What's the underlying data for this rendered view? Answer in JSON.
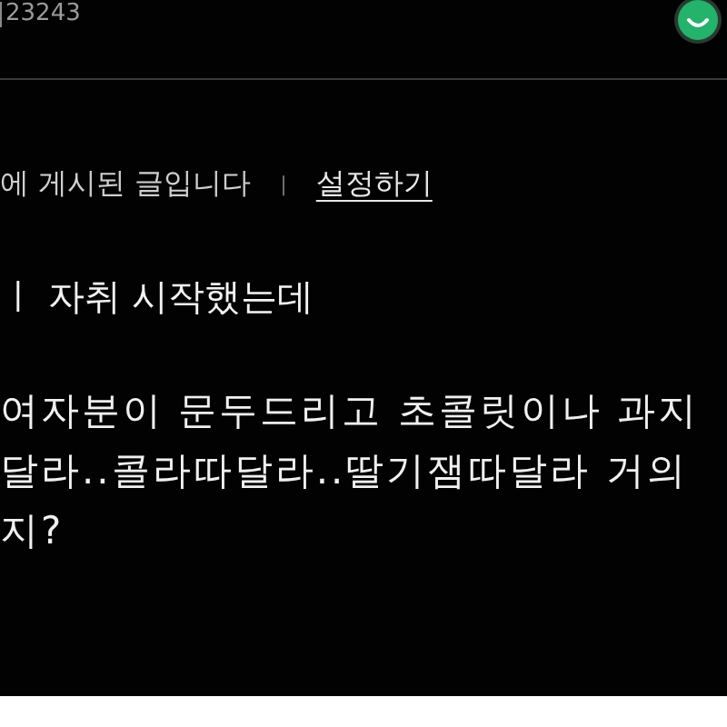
{
  "header": {
    "count": "23243"
  },
  "notice": {
    "text": "에 게시된 글입니다",
    "separator": "|",
    "link": "설정하기"
  },
  "post": {
    "title": "ㅣ 자취 시작했는데",
    "lines": [
      "여자분이 문두드리고 초콜릿이나 과지",
      "달라..콜라따달라..딸기잼따달라 거의",
      "지?"
    ]
  }
}
